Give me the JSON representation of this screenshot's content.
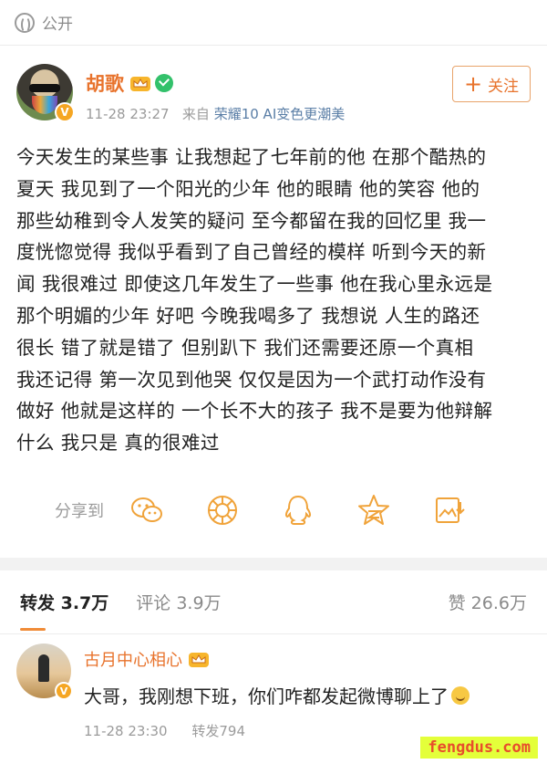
{
  "topbar": {
    "visibility": "公开",
    "icon": "globe-icon"
  },
  "post": {
    "author": "胡歌",
    "badges": [
      "crown-icon",
      "verified-check-icon"
    ],
    "time": "11-28 23:27",
    "source_prefix": "来自",
    "source": "荣耀10 AI变色更潮美",
    "follow_label": "关注",
    "text_lines": [
      "今天发生的某些事 让我想起了七年前的他 在那个酷热的",
      "夏天 我见到了一个阳光的少年 他的眼睛 他的笑容 他的",
      "那些幼稚到令人发笑的疑问 至今都留在我的回忆里 我一",
      "度恍惚觉得 我似乎看到了自己曾经的模样 听到今天的新",
      "闻 我很难过 即使这几年发生了一些事 他在我心里永远是",
      "那个明媚的少年 好吧 今晚我喝多了 我想说 人生的路还",
      "很长 错了就是错了 但别趴下 我们还需要还原一个真相",
      "我还记得 第一次见到他哭 仅仅是因为一个武打动作没有",
      "做好 他就是这样的 一个长不大的孩子 我不是要为他辩解",
      "什么 我只是 真的很难过"
    ],
    "share_label": "分享到",
    "share_icons": [
      "wechat-icon",
      "moments-icon",
      "qq-icon",
      "qzone-icon",
      "save-image-icon"
    ]
  },
  "stats": {
    "repost": "转发 3.7万",
    "comment": "评论 3.9万",
    "likes": "赞 26.6万"
  },
  "comment": {
    "author": "古月中心相心",
    "text": "大哥，我刚想下班，你们咋都发起微博聊上了",
    "time": "11-28 23:30",
    "repost": "转发794"
  },
  "watermark": "fengdus.com",
  "colors": {
    "accent": "#e8732c",
    "link": "#5a7ea6",
    "muted": "#9b9b9b"
  }
}
